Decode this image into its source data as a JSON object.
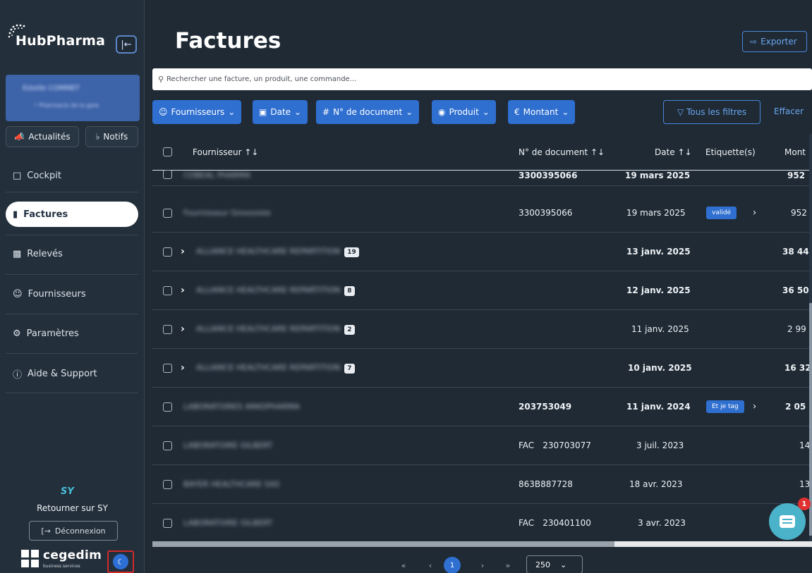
{
  "sidebar": {
    "brand": "HubPharma",
    "user": {
      "name": "Estelle COMMET",
      "subtitle": "• Pharmacie de la gare"
    },
    "news_label": "Actualités",
    "notifs_label": "Notifs",
    "items": [
      {
        "label": "Cockpit",
        "icon": "monitor-icon",
        "active": false
      },
      {
        "label": "Factures",
        "icon": "document-icon",
        "active": true
      },
      {
        "label": "Relevés",
        "icon": "clipboard-icon",
        "active": false
      },
      {
        "label": "Fournisseurs",
        "icon": "user-icon",
        "active": false
      },
      {
        "label": "Paramètres",
        "icon": "gear-icon",
        "active": false
      },
      {
        "label": "Aide & Support",
        "icon": "help-icon",
        "active": false
      }
    ],
    "sy_logo": "SY",
    "back_label": "Retourner sur SY",
    "logout_label": "Déconnexion",
    "cegedim_name": "cegedim",
    "cegedim_sub": "business services"
  },
  "header": {
    "title": "Factures",
    "export_label": "Exporter"
  },
  "search": {
    "placeholder": "Rechercher une facture, un produit, une commande..."
  },
  "filters": {
    "items": [
      {
        "icon": "user-icon",
        "label": "Fournisseurs"
      },
      {
        "icon": "calendar-icon",
        "label": "Date"
      },
      {
        "icon": "hash-icon",
        "label": "N° de document"
      },
      {
        "icon": "product-icon",
        "label": "Produit"
      },
      {
        "icon": "euro-icon",
        "label": "Montant"
      }
    ],
    "all_label": "Tous les filtres",
    "clear_label": "Effacer"
  },
  "table": {
    "columns": [
      "Fournisseur ↑↓",
      "N° de document ↑↓",
      "Date ↑↓",
      "Etiquette(s)",
      "Mont"
    ],
    "rows": [
      {
        "supplier": "COBEAL PHARMA",
        "doc": "3300395066",
        "date": "19 mars 2025",
        "tag": "",
        "amount": "952",
        "bold": true,
        "expand": false,
        "count": ""
      },
      {
        "supplier": "Fournisseur Grosssiste",
        "doc": "3300395066",
        "date": "19 mars 2025",
        "tag": "validé",
        "amount": "952",
        "bold": false,
        "expand": false,
        "count": ""
      },
      {
        "supplier": "ALLIANCE HEALTHCARE REPARTITION",
        "doc": "",
        "date": "13 janv. 2025",
        "tag": "",
        "amount": "38 44",
        "bold": true,
        "expand": true,
        "count": "19"
      },
      {
        "supplier": "ALLIANCE HEALTHCARE REPARTITION",
        "doc": "",
        "date": "12 janv. 2025",
        "tag": "",
        "amount": "36 50",
        "bold": true,
        "expand": true,
        "count": "8"
      },
      {
        "supplier": "ALLIANCE HEALTHCARE REPARTITION",
        "doc": "",
        "date": "11 janv. 2025",
        "tag": "",
        "amount": "2 99",
        "bold": false,
        "expand": true,
        "count": "2"
      },
      {
        "supplier": "ALLIANCE HEALTHCARE REPARTITION",
        "doc": "",
        "date": "10 janv. 2025",
        "tag": "",
        "amount": "16 32",
        "bold": true,
        "expand": true,
        "count": "7"
      },
      {
        "supplier": "LABORATOIRES ARKOPHARMA",
        "doc": "203753049",
        "date": "11 janv. 2024",
        "tag": "Et je tag",
        "amount": "2 05",
        "bold": true,
        "expand": false,
        "count": ""
      },
      {
        "supplier": "LABORATOIRE GILBERT",
        "doc": "FAC      230703077",
        "date": "3 juil. 2023",
        "tag": "",
        "amount": "14",
        "bold": false,
        "expand": false,
        "count": ""
      },
      {
        "supplier": "BAYER HEALTHCARE SAS",
        "doc": "863B887728",
        "date": "18 avr. 2023",
        "tag": "",
        "amount": "13",
        "bold": false,
        "expand": false,
        "count": ""
      },
      {
        "supplier": "LABORATOIRE GILBERT",
        "doc": "FAC      230401100",
        "date": "3 avr. 2023",
        "tag": "",
        "amount": "",
        "bold": false,
        "expand": false,
        "count": ""
      }
    ]
  },
  "pagination": {
    "first": "«",
    "prev": "‹",
    "current": "1",
    "next": "›",
    "last": "»",
    "page_size": "250"
  },
  "chat": {
    "badge": "1"
  },
  "colors": {
    "accent": "#2f6fd0",
    "sidebar": "#232f3b",
    "background": "#1f2a35",
    "chat": "#4ab3c9",
    "alert": "#e03030"
  }
}
